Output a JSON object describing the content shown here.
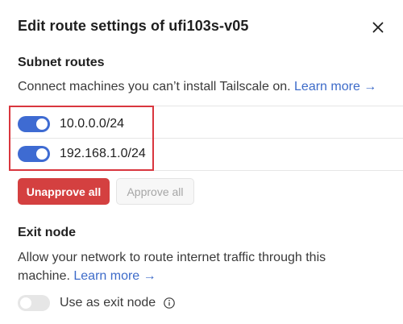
{
  "dialog": {
    "title": "Edit route settings of ufi103s-v05",
    "close_icon": "close-icon"
  },
  "subnet": {
    "heading": "Subnet routes",
    "description": "Connect machines you can’t install Tailscale on.",
    "learn_more": "Learn more →",
    "routes": [
      {
        "label": "10.0.0.0/24",
        "enabled": true
      },
      {
        "label": "192.168.1.0/24",
        "enabled": true
      }
    ],
    "unapprove_all": "Unapprove all",
    "approve_all": "Approve all"
  },
  "exit": {
    "heading": "Exit node",
    "description_line1": "Allow your network to route internet traffic through this",
    "description_line2": "machine.",
    "learn_more": "Learn more →",
    "toggle_label": "Use as exit node",
    "enabled": false,
    "info_icon": "info-icon"
  },
  "colors": {
    "accent": "#3e6bd2",
    "danger": "#d44040",
    "highlight_border": "#d9363e",
    "link": "#3d6bc9"
  }
}
